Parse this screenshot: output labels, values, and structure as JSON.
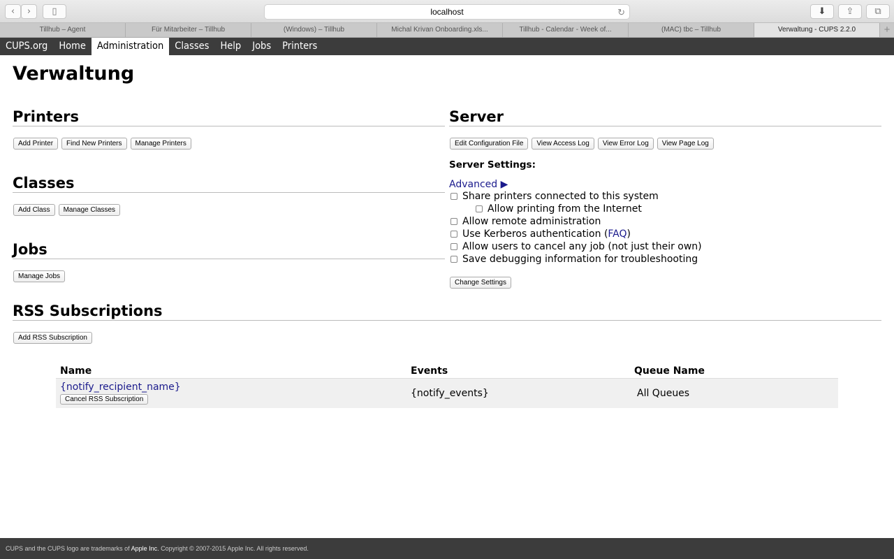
{
  "browser": {
    "url": "localhost",
    "tabs": [
      "Tillhub – Agent",
      "Für Mitarbeiter – Tillhub",
      "(Windows) – Tillhub",
      "Michal Krivan Onboarding.xls...",
      "Tillhub - Calendar - Week of...",
      "(MAC) tbc – Tillhub",
      "Verwaltung - CUPS 2.2.0"
    ],
    "new_tab": "+"
  },
  "nav": [
    "CUPS.org",
    "Home",
    "Administration",
    "Classes",
    "Help",
    "Jobs",
    "Printers"
  ],
  "title": "Verwaltung",
  "printers": {
    "heading": "Printers",
    "buttons": [
      "Add Printer",
      "Find New Printers",
      "Manage Printers"
    ]
  },
  "classes": {
    "heading": "Classes",
    "buttons": [
      "Add Class",
      "Manage Classes"
    ]
  },
  "jobs": {
    "heading": "Jobs",
    "buttons": [
      "Manage Jobs"
    ]
  },
  "server": {
    "heading": "Server",
    "buttons": [
      "Edit Configuration File",
      "View Access Log",
      "View Error Log",
      "View Page Log"
    ],
    "settings_label": "Server Settings:",
    "advanced": "Advanced ▶",
    "options": {
      "share": "Share printers connected to this system",
      "internet": "Allow printing from the Internet",
      "remote": "Allow remote administration",
      "kerberos_pre": "Use Kerberos authentication (",
      "kerberos_link": "FAQ",
      "kerberos_post": ")",
      "cancel": "Allow users to cancel any job (not just their own)",
      "debug": "Save debugging information for troubleshooting"
    },
    "change": "Change Settings"
  },
  "rss": {
    "heading": "RSS Subscriptions",
    "add": "Add RSS Subscription",
    "columns": [
      "Name",
      "Events",
      "Queue Name"
    ],
    "row": {
      "name": "{notify_recipient_name}",
      "cancel": "Cancel RSS Subscription",
      "events": "{notify_events}",
      "queue": "All Queues"
    }
  },
  "footer": {
    "pre": "CUPS and the CUPS logo are trademarks of ",
    "apple": "Apple Inc.",
    "post": " Copyright © 2007-2015 Apple Inc. All rights reserved."
  }
}
